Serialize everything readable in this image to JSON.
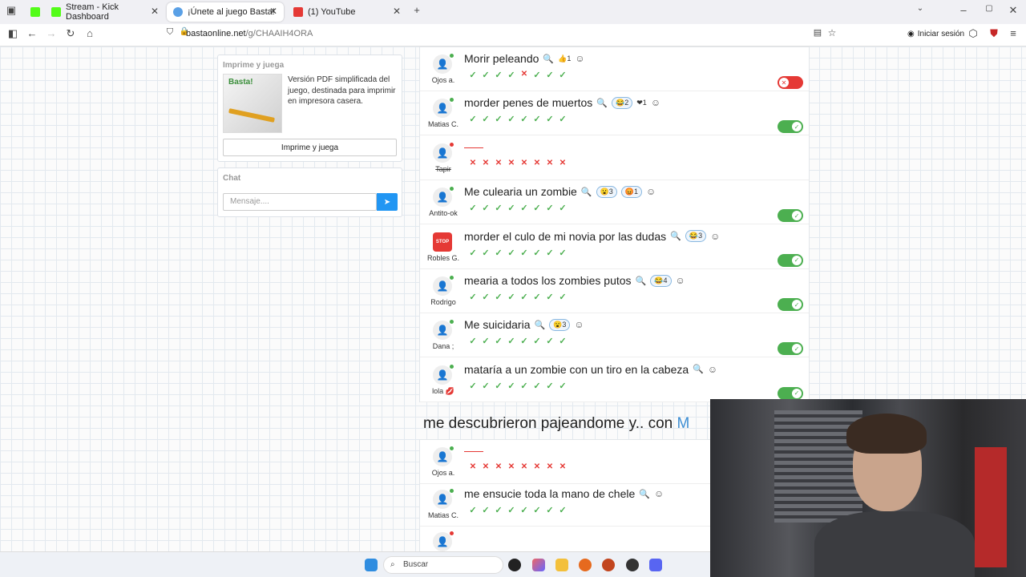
{
  "browser": {
    "tabs": [
      {
        "label": "",
        "icon": "kick-icon"
      },
      {
        "label": "Stream - Kick Dashboard",
        "icon": "kick-icon"
      },
      {
        "label": "¡Únete al juego Basta!",
        "icon": "basta-icon",
        "active": true
      },
      {
        "label": "(1) YouTube",
        "icon": "youtube-icon"
      }
    ],
    "url_host": "bastaonline.net",
    "url_path": "/g/CHAAIH4ORA",
    "signin_label": "Iniciar sesión"
  },
  "sidebar": {
    "print_title": "Imprime y juega",
    "print_logo_text": "Basta!",
    "print_description": "Versión PDF simplificada del juego, destinada para imprimir en impresora casera.",
    "print_button": "Imprime y juega",
    "chat_title": "Chat",
    "chat_placeholder": "Mensaje...."
  },
  "answers": [
    {
      "user": "Ojos a.",
      "text": "Morir peleando",
      "reactions": [
        {
          "emoji": "👍",
          "count": "1",
          "bare": true
        }
      ],
      "votes": [
        "ok",
        "ok",
        "ok",
        "ok",
        "no",
        "ok",
        "ok",
        "ok"
      ],
      "valid": false,
      "online": true
    },
    {
      "user": "Matias C.",
      "text": "morder penes de muertos",
      "reactions": [
        {
          "emoji": "😂",
          "count": "2"
        },
        {
          "emoji": "❤",
          "count": "1",
          "bare": true
        }
      ],
      "votes": [
        "ok",
        "ok",
        "ok",
        "ok",
        "ok",
        "ok",
        "ok",
        "ok"
      ],
      "valid": true,
      "online": true
    },
    {
      "user": "Tapir",
      "text": "",
      "reactions": [],
      "votes": [
        "no",
        "no",
        "no",
        "no",
        "no",
        "no",
        "no",
        "no"
      ],
      "valid": null,
      "online": false,
      "strike": true
    },
    {
      "user": "Antito-ok",
      "text": "Me culearia un zombie",
      "reactions": [
        {
          "emoji": "😮",
          "count": "3"
        },
        {
          "emoji": "😡",
          "count": "1"
        }
      ],
      "votes": [
        "ok",
        "ok",
        "ok",
        "ok",
        "ok",
        "ok",
        "ok",
        "ok"
      ],
      "valid": true,
      "online": true
    },
    {
      "user": "Robles G.",
      "text": "morder el culo de mi novia por las dudas",
      "reactions": [
        {
          "emoji": "😂",
          "count": "3"
        }
      ],
      "votes": [
        "ok",
        "ok",
        "ok",
        "ok",
        "ok",
        "ok",
        "ok",
        "ok"
      ],
      "valid": true,
      "online": false,
      "stop": true
    },
    {
      "user": "Rodrigo",
      "text": "mearia a todos los zombies putos",
      "reactions": [
        {
          "emoji": "😂",
          "count": "4"
        }
      ],
      "votes": [
        "ok",
        "ok",
        "ok",
        "ok",
        "ok",
        "ok",
        "ok",
        "ok"
      ],
      "valid": true,
      "online": true
    },
    {
      "user": "Dana ;",
      "text": "Me suicidaria",
      "reactions": [
        {
          "emoji": "😮",
          "count": "3"
        }
      ],
      "votes": [
        "ok",
        "ok",
        "ok",
        "ok",
        "ok",
        "ok",
        "ok",
        "ok"
      ],
      "valid": true,
      "online": true
    },
    {
      "user": "lola 💋",
      "text": "mataría a un zombie con un tiro en la cabeza",
      "reactions": [],
      "votes": [
        "ok",
        "ok",
        "ok",
        "ok",
        "ok",
        "ok",
        "ok",
        "ok"
      ],
      "valid": true,
      "online": true
    }
  ],
  "question2": {
    "text": "me descubrieron pajeandome y.. con",
    "letter": "M"
  },
  "answers2": [
    {
      "user": "Ojos a.",
      "text": "",
      "votes": [
        "no",
        "no",
        "no",
        "no",
        "no",
        "no",
        "no",
        "no"
      ],
      "online": true
    },
    {
      "user": "Matias C.",
      "text": "me ensucie toda la mano de chele",
      "votes": [
        "ok",
        "ok",
        "ok",
        "ok",
        "ok",
        "ok",
        "ok",
        "ok"
      ],
      "online": true
    },
    {
      "user": "",
      "text": "",
      "votes": [],
      "online": false
    }
  ],
  "taskbar": {
    "search_label": "Buscar"
  },
  "colors": {
    "accent": "#2196f3",
    "valid": "#4caf50",
    "invalid": "#e53935"
  }
}
